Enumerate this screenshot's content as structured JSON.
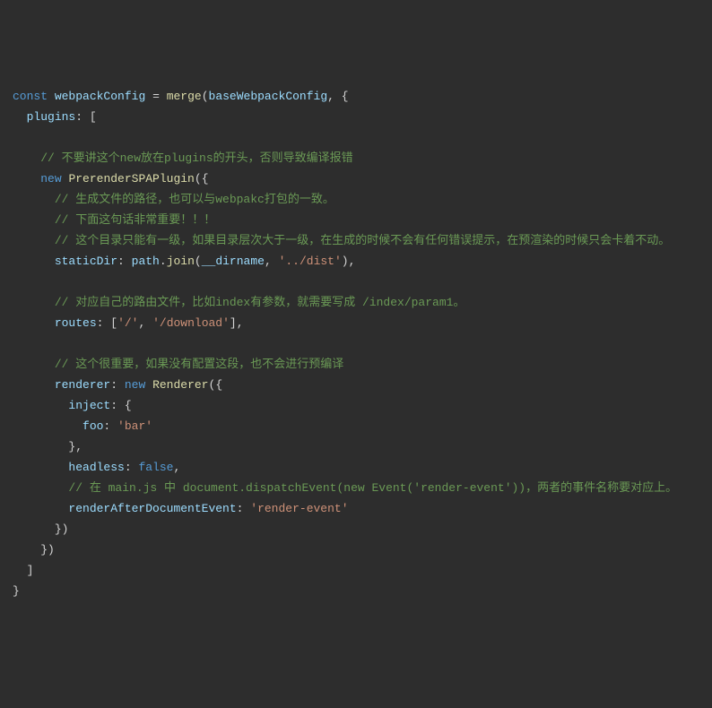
{
  "code": {
    "const_kw": "const",
    "var_webpackConfig": "webpackConfig",
    "fn_merge": "merge",
    "var_baseWebpackConfig": "baseWebpackConfig",
    "prop_plugins": "plugins",
    "comment1": "// 不要讲这个new放在plugins的开头，否则导致编译报错",
    "new_kw": "new",
    "cls_PrerenderSPAPlugin": "PrerenderSPAPlugin",
    "comment2": "// 生成文件的路径，也可以与webpakc打包的一致。",
    "comment3": "// 下面这句话非常重要！！！",
    "comment4": "// 这个目录只能有一级，如果目录层次大于一级，在生成的时候不会有任何错误提示，在预渲染的时候只会卡着不动。",
    "prop_staticDir": "staticDir",
    "obj_path": "path",
    "fn_join": "join",
    "var_dirname": "__dirname",
    "str_dist": "'../dist'",
    "comment5": "// 对应自己的路由文件，比如index有参数，就需要写成 /index/param1。",
    "prop_routes": "routes",
    "str_root": "'/'",
    "str_download": "'/download'",
    "comment6": "// 这个很重要，如果没有配置这段，也不会进行预编译",
    "prop_renderer": "renderer",
    "cls_Renderer": "Renderer",
    "prop_inject": "inject",
    "prop_foo": "foo",
    "str_bar": "'bar'",
    "prop_headless": "headless",
    "bool_false": "false",
    "comment7": "// 在 main.js 中 document.dispatchEvent(new Event('render-event'))，两者的事件名称要对应上。",
    "prop_renderAfterDocumentEvent": "renderAfterDocumentEvent",
    "str_renderEvent": "'render-event'"
  }
}
